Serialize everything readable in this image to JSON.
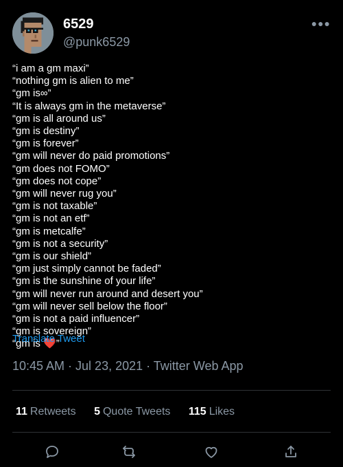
{
  "user": {
    "display_name": "6529",
    "handle": "@punk6529",
    "avatar_icon": "cryptopunk-avatar",
    "more_icon": "more-options-icon"
  },
  "tweet": {
    "lines": [
      "“i am a gm maxi”",
      "“nothing gm is alien to me”",
      "“gm is∞”",
      "“It is always gm in the metaverse”",
      "“gm is all around us”",
      "“gm is destiny”",
      "“gm is forever”",
      "“gm will never do paid promotions”",
      "“gm does not FOMO”",
      "“gm does not cope”",
      "“gm will never rug you”",
      "“gm is not taxable”",
      "“gm is not an etf”",
      "“gm is metcalfe”",
      "“gm is not a security”",
      "“gm is our shield”",
      "“gm just simply cannot be faded”",
      "“gm is the sunshine of your life”",
      "“gm will never run around and desert you”",
      "“gm will never sell below the floor”",
      "“gm is not a paid influencer”",
      "“gm is sovereign”"
    ],
    "last_line_prefix": "“gm is ",
    "last_line_heart": "❤️",
    "last_line_suffix": "”",
    "translate_label": "Translate Tweet"
  },
  "meta": {
    "timestamp": "10:45 AM · Jul 23, 2021 · Twitter Web App"
  },
  "stats": {
    "retweets_count": "11",
    "retweets_label": "Retweets",
    "quotes_count": "5",
    "quotes_label": "Quote Tweets",
    "likes_count": "115",
    "likes_label": "Likes"
  },
  "actions": [
    "reply-icon",
    "retweet-icon",
    "like-icon",
    "share-icon"
  ],
  "colors": {
    "background": "#000000",
    "text": "#ffffff",
    "secondary_text": "#8b98a5",
    "link": "#1d9bf0",
    "divider": "#2f3336",
    "heart": "#e0245e"
  }
}
